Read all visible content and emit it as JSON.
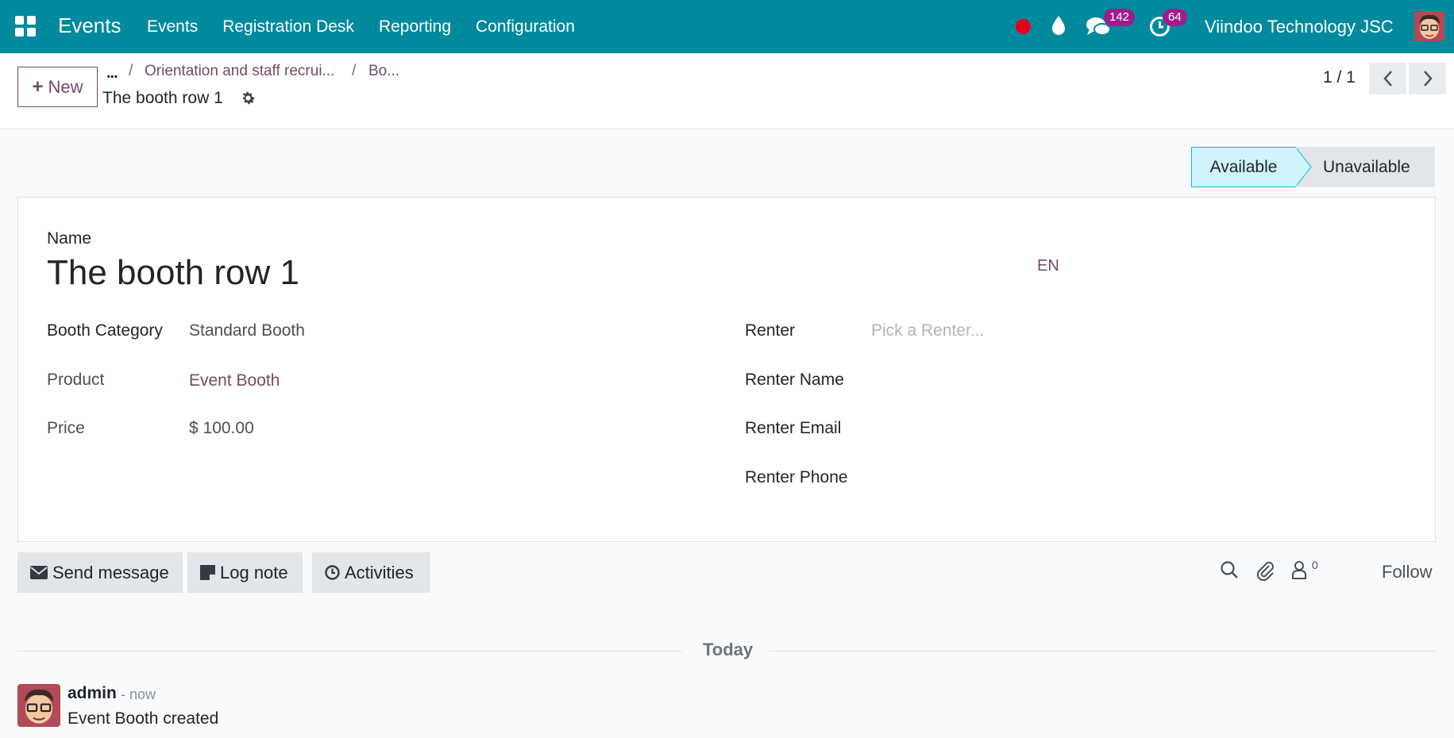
{
  "navbar": {
    "brand": "Events",
    "menu": [
      "Events",
      "Registration Desk",
      "Reporting",
      "Configuration"
    ],
    "messages_count": "142",
    "activities_count": "64",
    "company": "Viindoo Technology JSC"
  },
  "control": {
    "new_label": "New",
    "breadcrumbs": [
      "...",
      "Orientation and staff recrui...",
      "Bo..."
    ],
    "record_title": "The booth row 1",
    "pager": "1 / 1"
  },
  "status": {
    "options": [
      "Available",
      "Unavailable"
    ],
    "current": "Available"
  },
  "form": {
    "name_label": "Name",
    "name_value": "The booth row 1",
    "lang": "EN",
    "left_fields": [
      {
        "label": "Booth Category",
        "value": "Standard Booth"
      },
      {
        "label": "Product",
        "value": "Event Booth"
      },
      {
        "label": "Price",
        "value": "$ 100.00"
      }
    ],
    "right_fields": [
      {
        "label": "Renter",
        "placeholder": "Pick a Renter..."
      },
      {
        "label": "Renter Name",
        "value": ""
      },
      {
        "label": "Renter Email",
        "value": ""
      },
      {
        "label": "Renter Phone",
        "value": ""
      }
    ]
  },
  "chatter": {
    "buttons": [
      "Send message",
      "Log note",
      "Activities"
    ],
    "followers_count": "0",
    "follow_label": "Follow",
    "date_separator": "Today",
    "messages": [
      {
        "author": "admin",
        "time": "- now",
        "body": "Event Booth created"
      }
    ]
  },
  "colors": {
    "navbar": "#018a9e",
    "primary": "#714b67",
    "badge": "#9c1d8b",
    "status_active": "#cff4fc"
  }
}
